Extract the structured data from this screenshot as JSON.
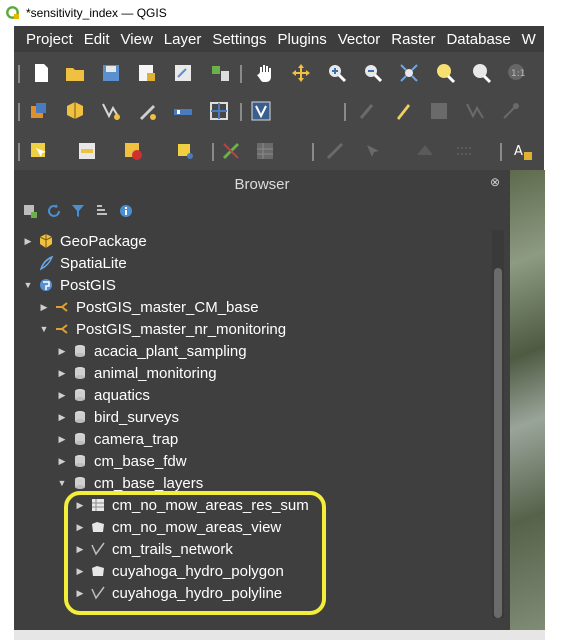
{
  "window": {
    "title": "*sensitivity_index — QGIS"
  },
  "menu": [
    "Project",
    "Edit",
    "View",
    "Layer",
    "Settings",
    "Plugins",
    "Vector",
    "Raster",
    "Database",
    "W"
  ],
  "browser": {
    "title": "Browser",
    "items": [
      {
        "label": "GeoPackage",
        "icon": "geopackage-icon",
        "expanded": false
      },
      {
        "label": "SpatiaLite",
        "icon": "spatialite-icon",
        "expanded": null
      },
      {
        "label": "PostGIS",
        "icon": "postgis-icon",
        "expanded": true
      },
      {
        "label": "PostGIS_master_CM_base",
        "icon": "connection-icon",
        "expanded": false
      },
      {
        "label": "PostGIS_master_nr_monitoring",
        "icon": "connection-icon",
        "expanded": true
      },
      {
        "label": "acacia_plant_sampling",
        "icon": "database-icon",
        "expanded": false
      },
      {
        "label": "animal_monitoring",
        "icon": "database-icon",
        "expanded": false
      },
      {
        "label": "aquatics",
        "icon": "database-icon",
        "expanded": false
      },
      {
        "label": "bird_surveys",
        "icon": "database-icon",
        "expanded": false
      },
      {
        "label": "camera_trap",
        "icon": "database-icon",
        "expanded": false
      },
      {
        "label": "cm_base_fdw",
        "icon": "database-icon",
        "expanded": false
      },
      {
        "label": "cm_base_layers",
        "icon": "database-icon",
        "expanded": true
      },
      {
        "label": "cm_no_mow_areas_res_sum",
        "icon": "table-icon",
        "expanded": false
      },
      {
        "label": "cm_no_mow_areas_view",
        "icon": "polygon-layer-icon",
        "expanded": false
      },
      {
        "label": "cm_trails_network",
        "icon": "line-layer-icon",
        "expanded": false
      },
      {
        "label": "cuyahoga_hydro_polygon",
        "icon": "polygon-layer-icon",
        "expanded": false
      },
      {
        "label": "cuyahoga_hydro_polyline",
        "icon": "line-layer-icon",
        "expanded": false
      }
    ]
  },
  "colors": {
    "highlight": "#f2ee3a",
    "panel": "#3f3f3f",
    "toolbar": "#474747"
  }
}
